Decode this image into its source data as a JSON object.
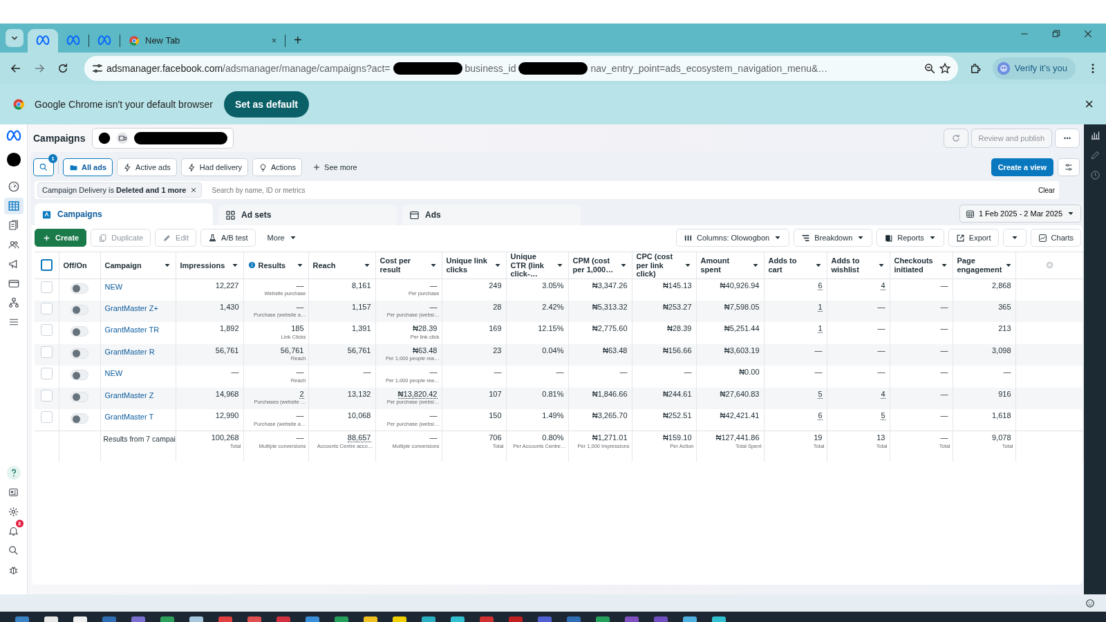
{
  "browser": {
    "tabs": [
      {
        "kind": "meta",
        "selected": true
      },
      {
        "kind": "meta",
        "selected": false
      },
      {
        "kind": "meta",
        "selected": false
      },
      {
        "kind": "chrome",
        "title": "New Tab",
        "close": "×",
        "selected": false
      }
    ],
    "new_tab": "+",
    "url_parts": [
      "adsmanager.facebook.com/adsmanager/manage/campaigns?act=",
      "business_id",
      "nav_entry_point=ads_ecosystem_navigation_menu&…"
    ],
    "verify_button": "Verify it's you",
    "infobar": {
      "message": "Google Chrome isn't your default browser",
      "button": "Set as default",
      "close": "×"
    }
  },
  "sidebar": {
    "items": [
      {
        "selected": false
      },
      {
        "selected": true
      },
      {
        "selected": false
      },
      {
        "selected": false
      },
      {
        "selected": false
      },
      {
        "selected": false
      },
      {
        "selected": false
      },
      {
        "selected": false
      }
    ],
    "notification_badge": "3"
  },
  "header": {
    "title": "Campaigns",
    "review_button": "Review and publish"
  },
  "filters": {
    "search_badge": "1",
    "chips": [
      {
        "label": "All ads",
        "selected": true
      },
      {
        "label": "Active ads",
        "selected": false
      },
      {
        "label": "Had delivery",
        "selected": false
      },
      {
        "label": "Actions",
        "selected": false
      }
    ],
    "see_more": "See more",
    "create_view": "Create a view"
  },
  "filter_bar": {
    "chip": "Campaign Delivery is **Deleted and 1 more**",
    "placeholder": "Search by name, ID or metrics",
    "clear": "Clear"
  },
  "level_tabs": [
    {
      "label": "Campaigns",
      "selected": true
    },
    {
      "label": "Ad sets",
      "selected": false
    },
    {
      "label": "Ads",
      "selected": false
    }
  ],
  "date_range": "1 Feb 2025 - 2 Mar 2025",
  "toolbar": {
    "left": [
      {
        "label": "Create",
        "kind": "primary",
        "disabled": false
      },
      {
        "label": "Duplicate",
        "kind": "plain",
        "disabled": true
      },
      {
        "label": "Edit",
        "kind": "plain",
        "disabled": true
      },
      {
        "label": "A/B test",
        "kind": "plain",
        "disabled": false
      },
      {
        "label": "More",
        "kind": "menu",
        "disabled": false
      }
    ],
    "right": [
      {
        "label": "Columns: Olowogbon",
        "kind": "menu"
      },
      {
        "label": "Breakdown",
        "kind": "menu"
      },
      {
        "label": "Reports",
        "kind": "menu"
      },
      {
        "label": "Export",
        "kind": "plain"
      },
      {
        "kind": "menu"
      },
      {
        "label": "Charts",
        "kind": "plain"
      }
    ]
  },
  "table": {
    "all_checked": false,
    "fixed_columns": [
      {
        "label": "Off/On",
        "sortable": false
      },
      {
        "label": "Campaign",
        "sortable": true
      }
    ],
    "metric_columns": [
      {
        "label": "Impressions",
        "info": false
      },
      {
        "label": "Results",
        "info": true
      },
      {
        "label": "Reach",
        "info": false
      },
      {
        "label": "Cost per result",
        "info": false
      },
      {
        "label": "Unique link clicks",
        "info": false
      },
      {
        "label": "Unique CTR (link click-…",
        "info": false
      },
      {
        "label": "CPM (cost per 1,000…",
        "info": false
      },
      {
        "label": "CPC (cost per link click)",
        "info": false
      },
      {
        "label": "Amount spent",
        "info": false
      },
      {
        "label": "Adds to cart",
        "info": false
      },
      {
        "label": "Adds to wishlist",
        "info": false
      },
      {
        "label": "Checkouts initiated",
        "info": false
      },
      {
        "label": "Page engagement",
        "info": false
      }
    ],
    "rows": [
      {
        "checked": false,
        "on": false,
        "campaign": "NEW",
        "cells": [
          {
            "text": "12,227",
            "dotted": false
          },
          {
            "text": "—",
            "note": "Website purchase",
            "dotted": false
          },
          {
            "text": "8,161",
            "dotted": false
          },
          {
            "text": "—",
            "note": "Per purchase",
            "dotted": false
          },
          {
            "text": "249",
            "dotted": false
          },
          {
            "text": "3.05%",
            "dotted": false
          },
          {
            "text": "₦3,347.26",
            "dotted": false
          },
          {
            "text": "₦145.13",
            "dotted": false
          },
          {
            "text": "₦40,926.94",
            "dotted": false
          },
          {
            "text": "6",
            "dotted": true
          },
          {
            "text": "4",
            "dotted": true
          },
          {
            "text": "—",
            "dotted": false
          },
          {
            "text": "2,868",
            "dotted": false
          }
        ]
      },
      {
        "checked": false,
        "on": false,
        "campaign": "GrantMaster Z+",
        "cells": [
          {
            "text": "1,430",
            "dotted": false
          },
          {
            "text": "—",
            "note": "Purchase (website a…",
            "dotted": false
          },
          {
            "text": "1,157",
            "dotted": false
          },
          {
            "text": "—",
            "note": "Per purchase (websi…",
            "dotted": false
          },
          {
            "text": "28",
            "dotted": false
          },
          {
            "text": "2.42%",
            "dotted": false
          },
          {
            "text": "₦5,313.32",
            "dotted": false
          },
          {
            "text": "₦253.27",
            "dotted": false
          },
          {
            "text": "₦7,598.05",
            "dotted": false
          },
          {
            "text": "1",
            "dotted": true
          },
          {
            "text": "—",
            "dotted": false
          },
          {
            "text": "—",
            "dotted": false
          },
          {
            "text": "365",
            "dotted": false
          }
        ]
      },
      {
        "checked": false,
        "on": false,
        "campaign": "GrantMaster TR",
        "cells": [
          {
            "text": "1,892",
            "dotted": false
          },
          {
            "text": "185",
            "note": "Link Clicks",
            "dotted": false
          },
          {
            "text": "1,391",
            "dotted": false
          },
          {
            "text": "₦28.39",
            "note": "Per link click",
            "dotted": false
          },
          {
            "text": "169",
            "dotted": false
          },
          {
            "text": "12.15%",
            "dotted": false
          },
          {
            "text": "₦2,775.60",
            "dotted": false
          },
          {
            "text": "₦28.39",
            "dotted": false
          },
          {
            "text": "₦5,251.44",
            "dotted": false
          },
          {
            "text": "1",
            "dotted": true
          },
          {
            "text": "—",
            "dotted": false
          },
          {
            "text": "—",
            "dotted": false
          },
          {
            "text": "213",
            "dotted": false
          }
        ]
      },
      {
        "checked": false,
        "on": false,
        "campaign": "GrantMaster R",
        "cells": [
          {
            "text": "56,761",
            "dotted": false
          },
          {
            "text": "56,761",
            "note": "Reach",
            "dotted": false
          },
          {
            "text": "56,761",
            "dotted": false
          },
          {
            "text": "₦63.48",
            "note": "Per 1,000 people rea…",
            "dotted": false
          },
          {
            "text": "23",
            "dotted": false
          },
          {
            "text": "0.04%",
            "dotted": false
          },
          {
            "text": "₦63.48",
            "dotted": false
          },
          {
            "text": "₦156.66",
            "dotted": false
          },
          {
            "text": "₦3,603.19",
            "dotted": false
          },
          {
            "text": "—",
            "dotted": false
          },
          {
            "text": "—",
            "dotted": false
          },
          {
            "text": "—",
            "dotted": false
          },
          {
            "text": "3,098",
            "dotted": false
          }
        ]
      },
      {
        "checked": false,
        "on": false,
        "campaign": "NEW",
        "cells": [
          {
            "text": "—",
            "dotted": false
          },
          {
            "text": "—",
            "note": "Reach",
            "dotted": false
          },
          {
            "text": "—",
            "dotted": false
          },
          {
            "text": "—",
            "note": "Per 1,000 people rea…",
            "dotted": false
          },
          {
            "text": "—",
            "dotted": false
          },
          {
            "text": "—",
            "dotted": false
          },
          {
            "text": "—",
            "dotted": false
          },
          {
            "text": "—",
            "dotted": false
          },
          {
            "text": "₦0.00",
            "dotted": false
          },
          {
            "text": "—",
            "dotted": false
          },
          {
            "text": "—",
            "dotted": false
          },
          {
            "text": "—",
            "dotted": false
          },
          {
            "text": "—",
            "dotted": false
          }
        ]
      },
      {
        "checked": false,
        "on": false,
        "campaign": "GrantMaster Z",
        "cells": [
          {
            "text": "14,968",
            "dotted": false
          },
          {
            "text": "2",
            "note": "Purchases (website …",
            "dotted": true
          },
          {
            "text": "13,132",
            "dotted": false
          },
          {
            "text": "₦13,820.42",
            "note": "Per purchase (websi…",
            "dotted": true
          },
          {
            "text": "107",
            "dotted": false
          },
          {
            "text": "0.81%",
            "dotted": false
          },
          {
            "text": "₦1,846.66",
            "dotted": false
          },
          {
            "text": "₦244.61",
            "dotted": false
          },
          {
            "text": "₦27,640.83",
            "dotted": false
          },
          {
            "text": "5",
            "dotted": true
          },
          {
            "text": "4",
            "dotted": true
          },
          {
            "text": "—",
            "dotted": false
          },
          {
            "text": "916",
            "dotted": false
          }
        ]
      },
      {
        "checked": false,
        "on": false,
        "campaign": "GrantMaster T",
        "cells": [
          {
            "text": "12,990",
            "dotted": false
          },
          {
            "text": "—",
            "note": "Purchase (website a…",
            "dotted": false
          },
          {
            "text": "10,068",
            "dotted": false
          },
          {
            "text": "—",
            "note": "Per purchase (websi…",
            "dotted": false
          },
          {
            "text": "150",
            "dotted": false
          },
          {
            "text": "1.49%",
            "dotted": false
          },
          {
            "text": "₦3,265.70",
            "dotted": false
          },
          {
            "text": "₦252.51",
            "dotted": false
          },
          {
            "text": "₦42,421.41",
            "dotted": false
          },
          {
            "text": "6",
            "dotted": true
          },
          {
            "text": "5",
            "dotted": true
          },
          {
            "text": "—",
            "dotted": false
          },
          {
            "text": "1,618",
            "dotted": false
          }
        ]
      }
    ],
    "summary": {
      "label": "Results from 7 campai",
      "cells": [
        {
          "text": "100,268",
          "note": "Total",
          "dotted": false
        },
        {
          "text": "—",
          "note": "Multiple conversions",
          "dotted": false
        },
        {
          "text": "88,657",
          "note": "Accounts Centre acco…",
          "dotted": true
        },
        {
          "text": "—",
          "note": "Multiple conversions",
          "dotted": false
        },
        {
          "text": "706",
          "note": "Total",
          "dotted": false
        },
        {
          "text": "0.80%",
          "note": "Per Accounts Centre…",
          "dotted": false
        },
        {
          "text": "₦1,271.01",
          "note": "Per 1,000 Impressions",
          "dotted": false
        },
        {
          "text": "₦159.10",
          "note": "Per Action",
          "dotted": false
        },
        {
          "text": "₦127,441.86",
          "note": "Total Spent",
          "dotted": false
        },
        {
          "text": "19",
          "note": "Total",
          "dotted": false
        },
        {
          "text": "13",
          "note": "Total",
          "dotted": false
        },
        {
          "text": "—",
          "note": "Total",
          "dotted": false
        },
        {
          "text": "9,078",
          "note": "Total",
          "dotted": false
        }
      ]
    }
  }
}
